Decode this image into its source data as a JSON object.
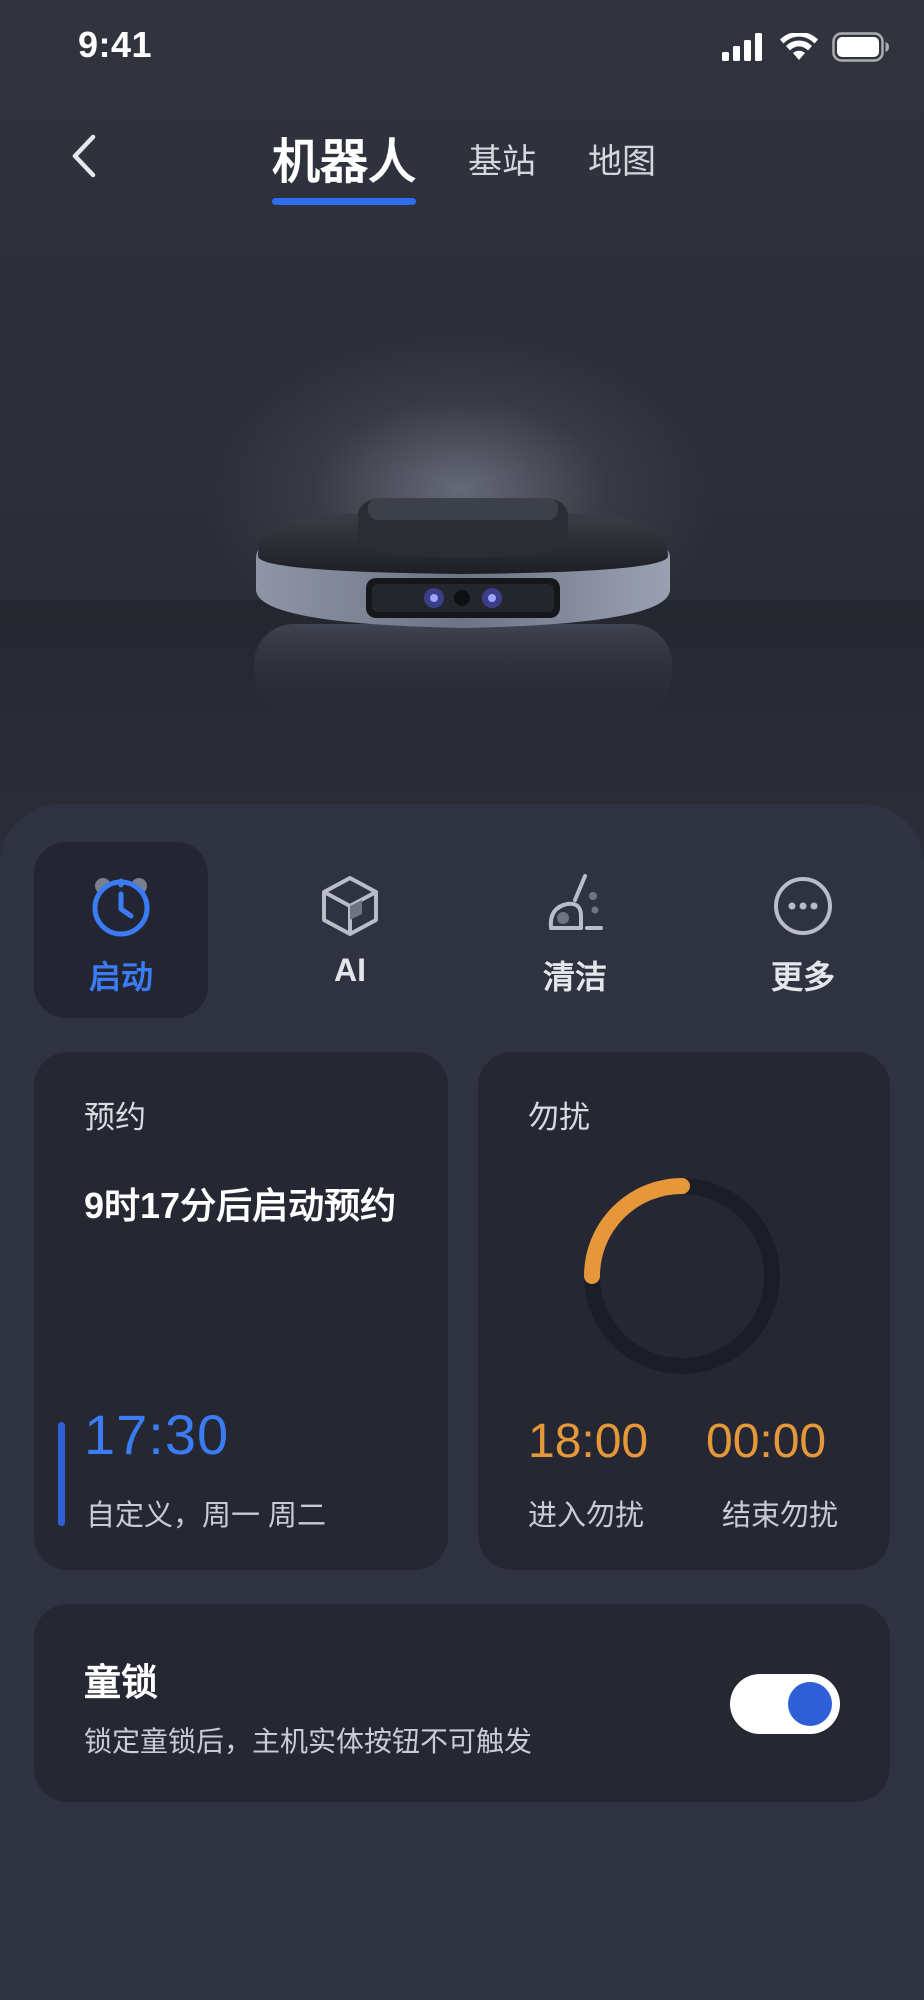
{
  "status_bar": {
    "time": "9:41"
  },
  "nav": {
    "tabs": [
      {
        "label": "机器人",
        "active": true
      },
      {
        "label": "基站",
        "active": false
      },
      {
        "label": "地图",
        "active": false
      }
    ]
  },
  "quick_actions": [
    {
      "label": "启动",
      "icon": "alarm-clock-icon",
      "active": true
    },
    {
      "label": "AI",
      "icon": "cube-icon",
      "active": false
    },
    {
      "label": "清洁",
      "icon": "cleaning-icon",
      "active": false
    },
    {
      "label": "更多",
      "icon": "more-icon",
      "active": false
    }
  ],
  "schedule": {
    "title": "预约",
    "description": "9时17分后启动预约",
    "time": "17:30",
    "repeat": "自定义，周一 周二"
  },
  "dnd": {
    "title": "勿扰",
    "start_time": "18:00",
    "start_label": "进入勿扰",
    "end_time": "00:00",
    "end_label": "结束勿扰"
  },
  "child_lock": {
    "title": "童锁",
    "subtitle": "锁定童锁后，主机实体按钮不可触发",
    "enabled": true
  },
  "colors": {
    "accent": "#2f6df0",
    "dnd_orange": "#e5973a",
    "background": "#2f3342"
  }
}
